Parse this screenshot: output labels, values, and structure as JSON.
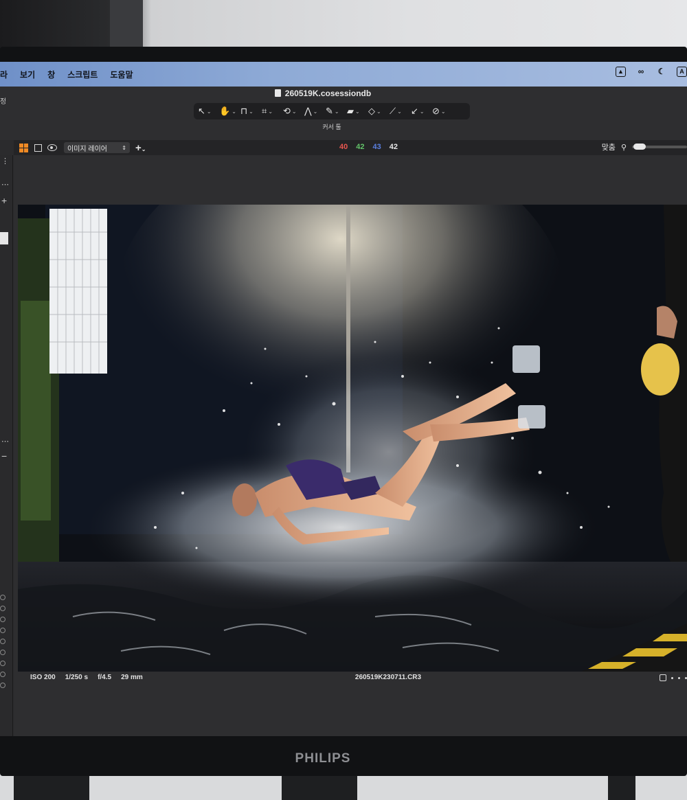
{
  "menubar": {
    "items": [
      "라",
      "보기",
      "창",
      "스크립트",
      "도움말"
    ]
  },
  "status_icons": [
    "drive-icon",
    "creative-cloud-icon",
    "moon-icon",
    "input-source-icon"
  ],
  "input_source_label": "A",
  "window": {
    "title": "260519K.cosessiondb"
  },
  "toolbar": {
    "tools": [
      {
        "name": "pointer-tool-icon",
        "glyph": "↖",
        "active": false
      },
      {
        "name": "hand-tool-icon",
        "glyph": "✋",
        "active": true
      },
      {
        "name": "stamp-tool-icon",
        "glyph": "⊓",
        "active": false
      },
      {
        "name": "crop-tool-icon",
        "glyph": "⌗",
        "active": false
      },
      {
        "name": "rotate-tool-icon",
        "glyph": "⟲",
        "active": false
      },
      {
        "name": "keystone-tool-icon",
        "glyph": "⋀",
        "active": false
      },
      {
        "name": "brush-tool-icon",
        "glyph": "✎",
        "active": false
      },
      {
        "name": "eraser-tool-icon",
        "glyph": "▰",
        "active": false
      },
      {
        "name": "gradient-tool-icon",
        "glyph": "◇",
        "active": false
      },
      {
        "name": "picker-tool-icon",
        "glyph": "⟋",
        "active": false
      },
      {
        "name": "annotate-tool-icon",
        "glyph": "↙",
        "active": false
      },
      {
        "name": "pen-tool-icon",
        "glyph": "⊘",
        "active": false
      }
    ],
    "label": "커서 툴"
  },
  "left_labels": [
    "정"
  ],
  "viewbar": {
    "layer_select": "이미지 레이어",
    "rgb": {
      "r": "40",
      "g": "42",
      "b": "43",
      "a": "42"
    },
    "rgb_colors": {
      "r": "#e8564f",
      "g": "#63c36a",
      "b": "#5a7fe0",
      "a": "#e6e6e6"
    },
    "fit_label": "맞춤"
  },
  "image_meta": {
    "iso": "ISO 200",
    "shutter": "1/250 s",
    "aperture": "f/4.5",
    "focal": "29 mm",
    "filename": "260519K230711.CR3"
  },
  "monitor": {
    "brand": "PHILIPS"
  },
  "colors": {
    "accent": "#f08a24",
    "menubar": "#8eaad6"
  }
}
